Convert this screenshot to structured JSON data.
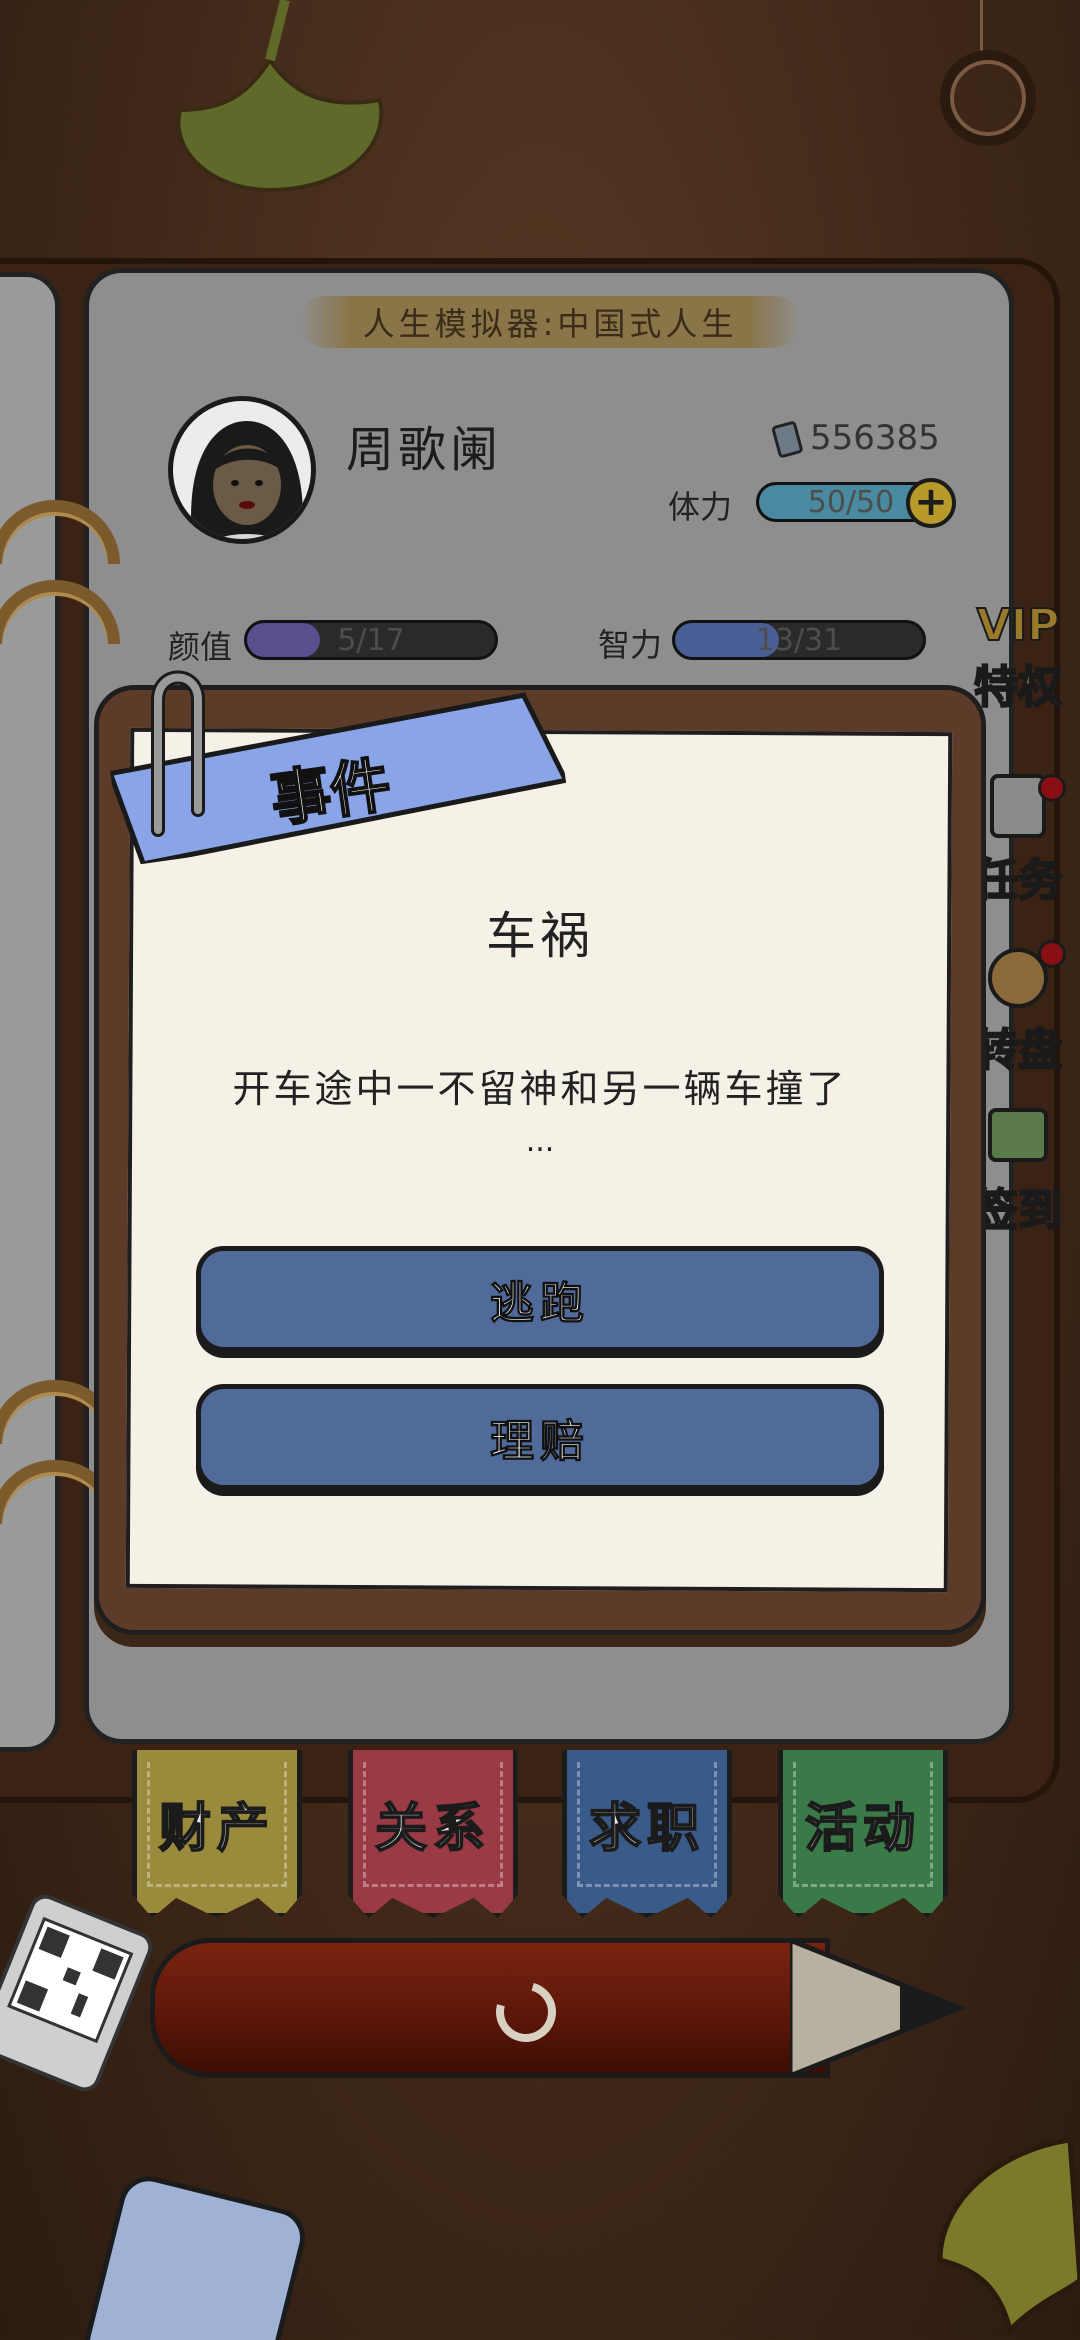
{
  "header": {
    "game_title": "人生模拟器:中国式人生"
  },
  "player": {
    "name": "周歌阑",
    "money": "556385",
    "stamina_label": "体力",
    "stamina_value": "50/50",
    "stamina_fraction": 1.0,
    "stats": {
      "looks_label": "颜值",
      "looks_value": "5/17",
      "looks_fraction": 0.294,
      "intelligence_label": "智力",
      "intelligence_value": "13/31",
      "intelligence_fraction": 0.419
    }
  },
  "side_menu": {
    "vip": "VIP",
    "privilege": "特权",
    "tasks": "任务",
    "wheel": "转盘",
    "checkin": "签到"
  },
  "event_modal": {
    "header": "事件",
    "title": "车祸",
    "description": "开车途中一不留神和另一辆车撞了",
    "ellipsis": "...",
    "choices": [
      "逃跑",
      "理赔"
    ]
  },
  "bottom_tabs": [
    {
      "label": "财产",
      "color": "#9a8a3c"
    },
    {
      "label": "关系",
      "color": "#9a3a44"
    },
    {
      "label": "求职",
      "color": "#3a5a8a"
    },
    {
      "label": "活动",
      "color": "#3a7a48"
    }
  ],
  "colors": {
    "choice_button": "#506a9a",
    "ribbon": "#8aa4e8",
    "stamina_bar": "#4a8aa0",
    "looks_bar": "#5a4e8e",
    "intel_bar": "#4a5e96"
  }
}
